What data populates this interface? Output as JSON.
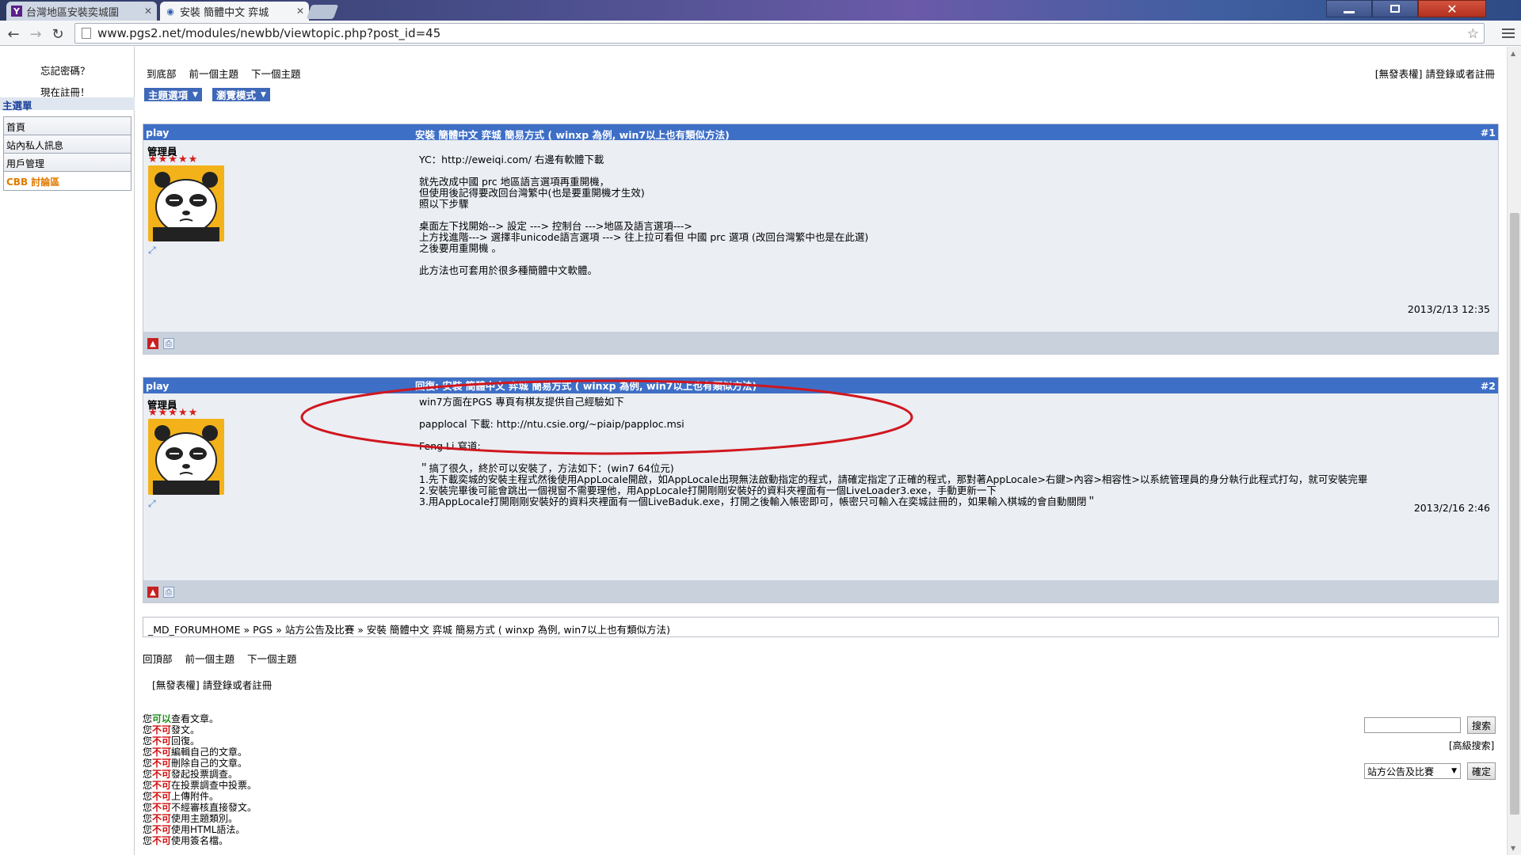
{
  "browser": {
    "tabs": [
      {
        "label": "台灣地區安裝奕城圍",
        "favicon": "Y",
        "active": false
      },
      {
        "label": "安裝 簡體中文 弈城",
        "favicon": "globe",
        "active": true
      }
    ],
    "url": "www.pgs2.net/modules/newbb/viewtopic.php?post_id=45"
  },
  "sidebar": {
    "forgot_password": "忘記密碼？",
    "register": "現在註冊！",
    "title": "主選單",
    "items": [
      "首頁",
      "站內私人訊息",
      "用戶管理",
      "CBB 討論區"
    ]
  },
  "topnav": {
    "links": [
      "到底部",
      "前一個主題",
      "下一個主題"
    ],
    "right_text": "[無發表權] 請登錄或者註冊",
    "dropdowns": [
      "主題選項",
      "瀏覽模式"
    ]
  },
  "posts": [
    {
      "author": "play",
      "title": "安裝 簡體中文 弈城 簡易方式 ( winxp 為例, win7以上也有類似方法)",
      "number": "#1",
      "role": "管理員",
      "stars": "★★★★★",
      "body": [
        "YC：http://eweiqi.com/ 右邊有軟體下載",
        "",
        "就先改成中國 prc 地區語言選項再重開機，",
        "但使用後記得要改回台灣繁中(也是要重開機才生效)",
        "照以下步驟",
        "",
        "桌面左下找開始--> 設定 ---> 控制台 --->地區及語言選項--->",
        "上方找進階---> 選擇非unicode語言選項 ---> 往上拉可看但 中國 prc 選項 (改回台灣繁中也是在此選)",
        "之後要用重開機 。",
        "",
        "此方法也可套用於很多種簡體中文軟體。"
      ],
      "time": "2013/2/13 12:35"
    },
    {
      "author": "play",
      "title": "回復: 安裝 簡體中文 弈城 簡易方式 ( winxp 為例, win7以上也有類似方法)",
      "number": "#2",
      "role": "管理員",
      "stars": "★★★★★",
      "body": [
        "win7方面在PGS 專頁有棋友提供自己經驗如下",
        "",
        "papplocal 下載: http://ntu.csie.org/~piaip/papploc.msi",
        "",
        "Feng Li 寫道:",
        "",
        "＂搞了很久，終於可以安裝了，方法如下：(win7 64位元)",
        "1.先下載奕城的安裝主程式然後使用AppLocale開啟，如AppLocale出現無法啟動指定的程式，請確定指定了正確的程式，那對著AppLocale>右鍵>內容>相容性>以系統管理員的身分執行此程式打勾，就可安裝完畢",
        "2.安裝完畢後可能會跳出一個視窗不需要理他，用AppLocale打開剛剛安裝好的資料夾裡面有一個LiveLoader3.exe，手動更新一下",
        "3.用AppLocale打開剛剛安裝好的資料夾裡面有一個LiveBaduk.exe，打開之後輸入帳密即可，帳密只可輸入在奕城註冊的，如果輸入棋城的會自動關閉＂"
      ],
      "time": "2013/2/16 2:46"
    }
  ],
  "breadcrumb": "_MD_FORUMHOME » PGS » 站方公告及比賽 » 安裝 簡體中文 弈城 簡易方式 ( winxp 為例, win7以上也有類似方法)",
  "bottomnav": {
    "links": [
      "回頂部",
      "前一個主題",
      "下一個主題"
    ],
    "no_post": "[無發表權] 請登錄或者註冊"
  },
  "permissions": [
    {
      "pre": "您",
      "mod": "可以",
      "can": true,
      "post": "查看文章。"
    },
    {
      "pre": "您",
      "mod": "不可",
      "can": false,
      "post": "發文。"
    },
    {
      "pre": "您",
      "mod": "不可",
      "can": false,
      "post": "回復。"
    },
    {
      "pre": "您",
      "mod": "不可",
      "can": false,
      "post": "編輯自己的文章。"
    },
    {
      "pre": "您",
      "mod": "不可",
      "can": false,
      "post": "刪除自己的文章。"
    },
    {
      "pre": "您",
      "mod": "不可",
      "can": false,
      "post": "發起投票調查。"
    },
    {
      "pre": "您",
      "mod": "不可",
      "can": false,
      "post": "在投票調查中投票。"
    },
    {
      "pre": "您",
      "mod": "不可",
      "can": false,
      "post": "上傳附件。"
    },
    {
      "pre": "您",
      "mod": "不可",
      "can": false,
      "post": "不經審核直接發文。"
    },
    {
      "pre": "您",
      "mod": "不可",
      "can": false,
      "post": "使用主題類別。"
    },
    {
      "pre": "您",
      "mod": "不可",
      "can": false,
      "post": "使用HTML語法。"
    },
    {
      "pre": "您",
      "mod": "不可",
      "can": false,
      "post": "使用簽名檔。"
    }
  ],
  "search": {
    "button": "搜索",
    "advanced": "[高級搜索]",
    "select_value": "站方公告及比賽",
    "confirm": "確定"
  },
  "colors": {
    "post_header": "#3e6fc6",
    "annotation": "#d0161e",
    "cannot": "#d01010",
    "can": "#1a8c1a"
  }
}
